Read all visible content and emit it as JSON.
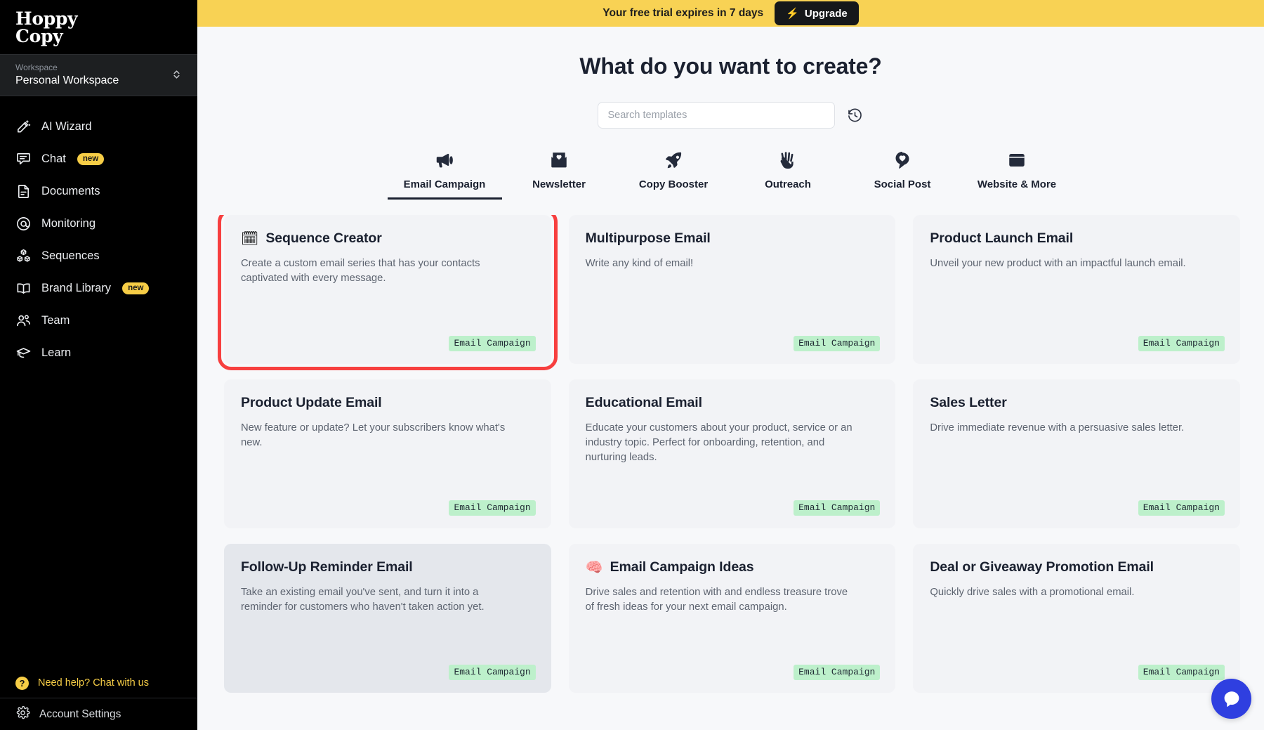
{
  "sidebar": {
    "logo_line1": "Hoppy",
    "logo_line2": "Copy",
    "workspace": {
      "label": "Workspace",
      "value": "Personal Workspace"
    },
    "items": [
      {
        "label": "AI Wizard",
        "icon": "magic-wand-icon",
        "badge": ""
      },
      {
        "label": "Chat",
        "icon": "chat-bubble-icon",
        "badge": "new"
      },
      {
        "label": "Documents",
        "icon": "document-icon",
        "badge": ""
      },
      {
        "label": "Monitoring",
        "icon": "at-sign-icon",
        "badge": ""
      },
      {
        "label": "Sequences",
        "icon": "blocks-icon",
        "badge": ""
      },
      {
        "label": "Brand Library",
        "icon": "book-icon",
        "badge": "new"
      },
      {
        "label": "Team",
        "icon": "users-icon",
        "badge": ""
      },
      {
        "label": "Learn",
        "icon": "graduation-cap-icon",
        "badge": ""
      }
    ],
    "help_label": "Need help? Chat with us",
    "settings_label": "Account Settings"
  },
  "banner": {
    "text": "Your free trial expires in 7 days",
    "upgrade_label": "Upgrade",
    "bolt": "⚡",
    "bg_color": "#f8d254"
  },
  "main": {
    "title": "What do you want to create?",
    "search": {
      "placeholder": "Search templates",
      "value": ""
    },
    "history_icon": "history-clock-icon"
  },
  "tabs": [
    {
      "label": "Email Campaign",
      "icon": "megaphone-icon",
      "active": true
    },
    {
      "label": "Newsletter",
      "icon": "envelope-heart-icon",
      "active": false
    },
    {
      "label": "Copy Booster",
      "icon": "rocket-icon",
      "active": false
    },
    {
      "label": "Outreach",
      "icon": "waving-hand-icon",
      "active": false
    },
    {
      "label": "Social Post",
      "icon": "speech-heart-icon",
      "active": false
    },
    {
      "label": "Website & More",
      "icon": "browser-window-icon",
      "active": false
    }
  ],
  "cards": [
    {
      "emoji": "🗓",
      "title": "Sequence Creator",
      "desc": "Create a custom email series that has your contacts captivated with every message.",
      "tag": "Email Campaign",
      "state": "selected"
    },
    {
      "emoji": "",
      "title": "Multipurpose Email",
      "desc": "Write any kind of email!",
      "tag": "Email Campaign",
      "state": "default"
    },
    {
      "emoji": "",
      "title": "Product Launch Email",
      "desc": "Unveil your new product with an impactful launch email.",
      "tag": "Email Campaign",
      "state": "default"
    },
    {
      "emoji": "",
      "title": "Product Update Email",
      "desc": "New feature or update? Let your subscribers know what's new.",
      "tag": "Email Campaign",
      "state": "default"
    },
    {
      "emoji": "",
      "title": "Educational Email",
      "desc": "Educate your customers about your product, service or an industry topic. Perfect for onboarding, retention, and nurturing leads.",
      "tag": "Email Campaign",
      "state": "default"
    },
    {
      "emoji": "",
      "title": "Sales Letter",
      "desc": "Drive immediate revenue with a persuasive sales letter.",
      "tag": "Email Campaign",
      "state": "default"
    },
    {
      "emoji": "",
      "title": "Follow-Up Reminder Email",
      "desc": "Take an existing email you've sent, and turn it into a reminder for customers who haven't taken action yet.",
      "tag": "Email Campaign",
      "state": "hovered"
    },
    {
      "emoji": "🧠",
      "title": "Email Campaign Ideas",
      "desc": "Drive sales and retention with and endless treasure trove of fresh ideas for your next email campaign.",
      "tag": "Email Campaign",
      "state": "default"
    },
    {
      "emoji": "",
      "title": "Deal or Giveaway Promotion Email",
      "desc": "Quickly drive sales with a promotional email.",
      "tag": "Email Campaign",
      "state": "default"
    }
  ],
  "chat_widget": {
    "icon": "chat-bubble-icon",
    "color": "#2f3fe0"
  },
  "colors": {
    "accent_yellow": "#f8d254",
    "selection_red": "#f73f3f",
    "tag_green": "#bdf0cb",
    "sidebar_black": "#000000"
  }
}
